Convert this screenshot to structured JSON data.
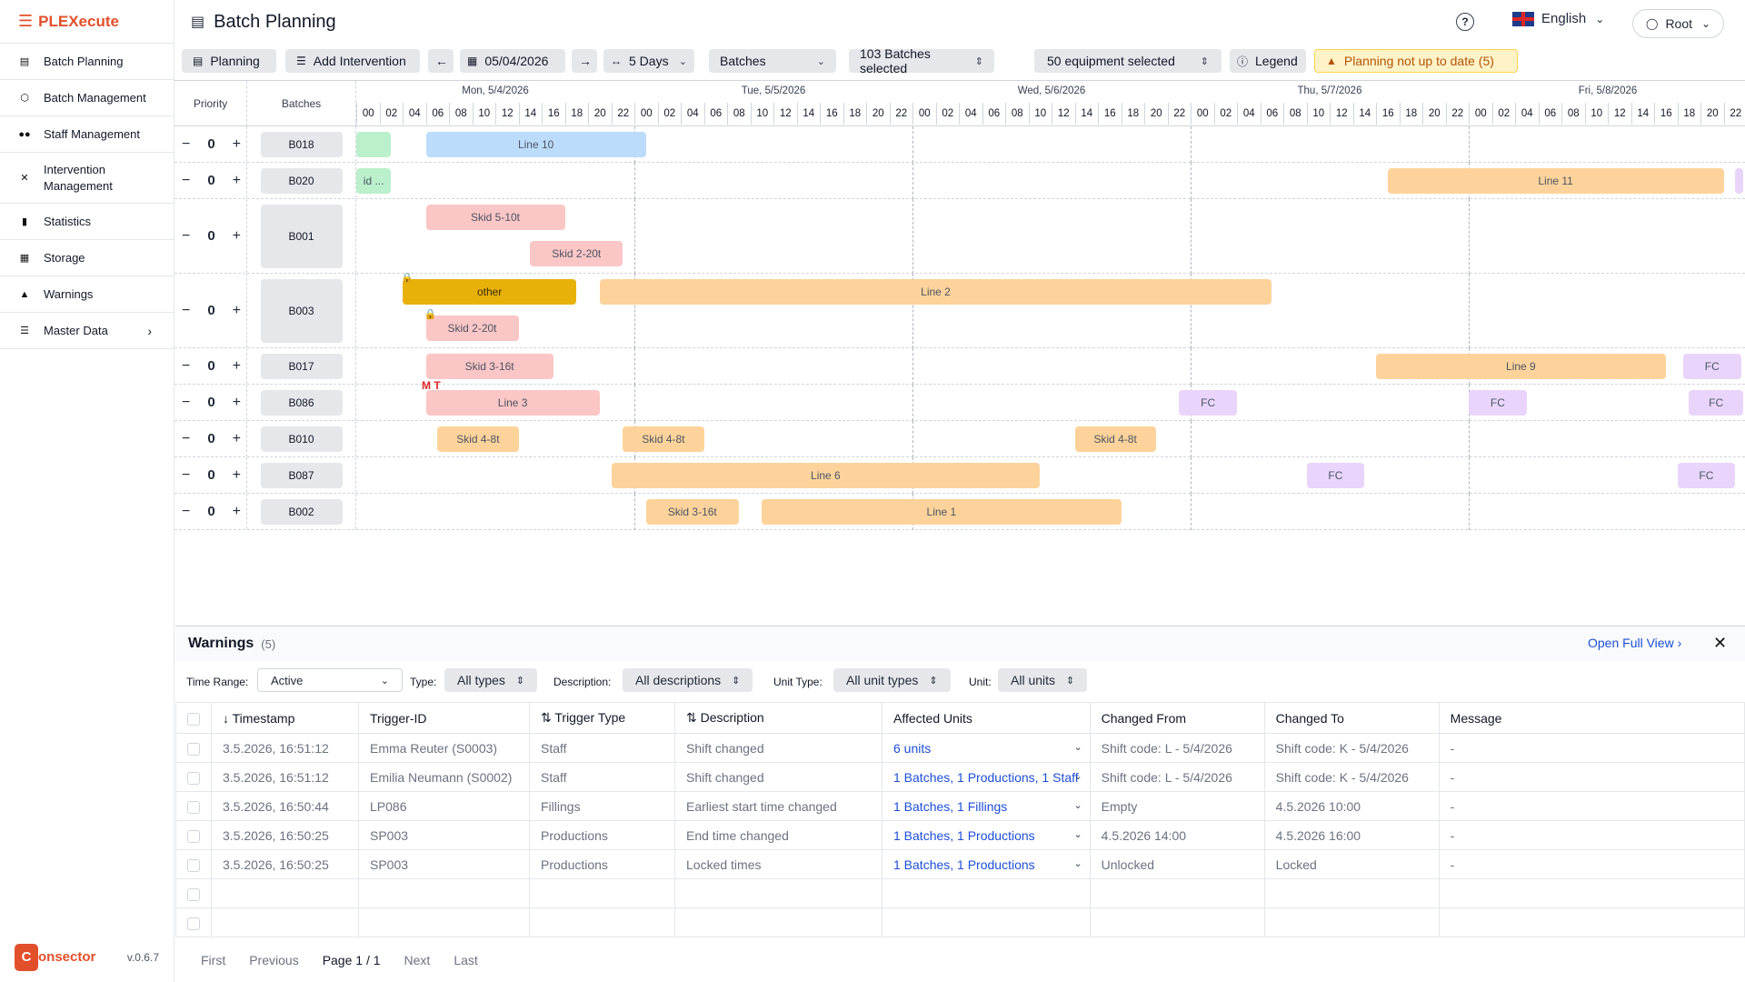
{
  "app": {
    "name": "PLEXecute",
    "version": "v.0.6.7",
    "brand": "onsector",
    "brand_letter": "C"
  },
  "sidebar": {
    "items": [
      {
        "label": "Batch Planning",
        "icon": "gantt-icon"
      },
      {
        "label": "Batch Management",
        "icon": "cube-icon"
      },
      {
        "label": "Staff Management",
        "icon": "people-icon"
      },
      {
        "label": "Intervention Management",
        "icon": "tools-icon"
      },
      {
        "label": "Statistics",
        "icon": "bar-chart-icon"
      },
      {
        "label": "Storage",
        "icon": "boxes-icon"
      },
      {
        "label": "Warnings",
        "icon": "warning-icon"
      },
      {
        "label": "Master Data",
        "icon": "database-icon"
      }
    ]
  },
  "header": {
    "title": "Batch Planning",
    "language": "English",
    "user": "Root",
    "help": "?"
  },
  "toolbar": {
    "planning": "Planning",
    "add_intervention": "Add Intervention",
    "date": "05/04/2026",
    "range": "5 Days",
    "view": "Batches",
    "batches_selected": "103 Batches selected",
    "equipment_selected": "50 equipment selected",
    "legend": "Legend",
    "warning": "Planning not up to date (5)"
  },
  "gantt": {
    "priority_header": "Priority",
    "batches_header": "Batches",
    "days": [
      "Mon, 5/4/2026",
      "Tue, 5/5/2026",
      "Wed, 5/6/2026",
      "Thu, 5/7/2026",
      "Fri, 5/8/2026"
    ],
    "hours": [
      "00",
      "02",
      "04",
      "06",
      "08",
      "10",
      "12",
      "14",
      "16",
      "18",
      "20",
      "22"
    ],
    "colors": {
      "orange": "#fdd39b",
      "pink": "#fbc6c6",
      "blue": "#bcdcfb",
      "green": "#bbf0cc",
      "purple": "#e9d5fb",
      "yellow": "#e8b10a"
    },
    "rows": [
      {
        "batch": "B018",
        "priority": "0",
        "bars": [
          {
            "label": "",
            "color": "green",
            "start_h": 0,
            "end_h": 3.0
          },
          {
            "label": "Line 10",
            "color": "blue",
            "start_h": 6.0,
            "end_h": 25.0
          }
        ]
      },
      {
        "batch": "B020",
        "priority": "0",
        "bars": [
          {
            "label": "id ...",
            "color": "green",
            "start_h": 0,
            "end_h": 3.0
          },
          {
            "label": "Line 11",
            "color": "orange",
            "start_h": 89.0,
            "end_h": 118.0
          },
          {
            "label": "",
            "color": "purple",
            "start_h": 119.0,
            "end_h": 121.0
          }
        ]
      },
      {
        "batch": "B001",
        "priority": "0",
        "bars": [
          {
            "label": "Skid 5-10t",
            "color": "pink",
            "start_h": 6.0,
            "end_h": 18.0
          },
          {
            "label": "Skid 2-20t",
            "color": "pink",
            "start_h": 15.0,
            "end_h": 23.0,
            "lane": 1
          }
        ]
      },
      {
        "batch": "B003",
        "priority": "0",
        "bars": [
          {
            "label": "other",
            "color": "yellow",
            "start_h": 4.0,
            "end_h": 19.0,
            "lock": true
          },
          {
            "label": "Line 2",
            "color": "orange",
            "start_h": 21.0,
            "end_h": 79.0
          },
          {
            "label": "Skid 2-20t",
            "color": "pink",
            "start_h": 6.0,
            "end_h": 14.0,
            "lane": 1,
            "lock": true
          }
        ]
      },
      {
        "batch": "B017",
        "priority": "0",
        "bars": [
          {
            "label": "Skid 3-16t",
            "color": "pink",
            "start_h": 6.0,
            "end_h": 17.0
          },
          {
            "label": "Line 9",
            "color": "orange",
            "start_h": 88.0,
            "end_h": 113.0
          },
          {
            "label": "FC",
            "color": "purple",
            "start_h": 114.5,
            "end_h": 119.5
          }
        ]
      },
      {
        "batch": "B086",
        "priority": "0",
        "markers": "M T",
        "bars": [
          {
            "label": "Line 3",
            "color": "pink",
            "start_h": 6.0,
            "end_h": 21.0
          },
          {
            "label": "FC",
            "color": "purple",
            "start_h": 71.0,
            "end_h": 76.0
          },
          {
            "label": "FC",
            "color": "purple",
            "start_h": 96.0,
            "end_h": 101.0
          },
          {
            "label": "FC",
            "color": "purple",
            "start_h": 115.0,
            "end_h": 120.0
          }
        ]
      },
      {
        "batch": "B010",
        "priority": "0",
        "bars": [
          {
            "label": "Skid 4-8t",
            "color": "orange",
            "start_h": 7.0,
            "end_h": 14.0
          },
          {
            "label": "Skid 4-8t",
            "color": "orange",
            "start_h": 23.0,
            "end_h": 30.0
          },
          {
            "label": "Skid 4-8t",
            "color": "orange",
            "start_h": 62.0,
            "end_h": 69.0
          }
        ]
      },
      {
        "batch": "B087",
        "priority": "0",
        "bars": [
          {
            "label": "Line 6",
            "color": "orange",
            "start_h": 22.0,
            "end_h": 59.0
          },
          {
            "label": "FC",
            "color": "purple",
            "start_h": 82.0,
            "end_h": 87.0
          },
          {
            "label": "FC",
            "color": "purple",
            "start_h": 114.0,
            "end_h": 119.0
          }
        ]
      },
      {
        "batch": "B002",
        "priority": "0",
        "bars": [
          {
            "label": "Skid 3-16t",
            "color": "orange",
            "start_h": 25.0,
            "end_h": 33.0
          },
          {
            "label": "Line 1",
            "color": "orange",
            "start_h": 35.0,
            "end_h": 66.0
          }
        ]
      }
    ]
  },
  "warnings": {
    "title": "Warnings",
    "count": "(5)",
    "open_full": "Open Full View",
    "filters": {
      "time_range_label": "Time Range:",
      "time_range": "Active",
      "type_label": "Type:",
      "type": "All types",
      "description_label": "Description:",
      "description": "All descriptions",
      "unit_type_label": "Unit Type:",
      "unit_type": "All unit types",
      "unit_label": "Unit:",
      "unit": "All units"
    },
    "columns": [
      "Timestamp",
      "Trigger-ID",
      "Trigger Type",
      "Description",
      "Affected Units",
      "Changed From",
      "Changed To",
      "Message"
    ],
    "rows": [
      {
        "timestamp": "3.5.2026, 16:51:12",
        "trigger_id": "Emma Reuter (S0003)",
        "trigger_type": "Staff",
        "description": "Shift changed",
        "affected": "6 units",
        "from": "Shift code: L - 5/4/2026",
        "to": "Shift code: K - 5/4/2026",
        "message": "-"
      },
      {
        "timestamp": "3.5.2026, 16:51:12",
        "trigger_id": "Emilia Neumann (S0002)",
        "trigger_type": "Staff",
        "description": "Shift changed",
        "affected": "1 Batches, 1 Productions, 1 Staff",
        "from": "Shift code: L - 5/4/2026",
        "to": "Shift code: K - 5/4/2026",
        "message": "-"
      },
      {
        "timestamp": "3.5.2026, 16:50:44",
        "trigger_id": "LP086",
        "trigger_type": "Fillings",
        "description": "Earliest start time changed",
        "affected": "1 Batches, 1 Fillings",
        "from": "Empty",
        "to": "4.5.2026 10:00",
        "message": "-"
      },
      {
        "timestamp": "3.5.2026, 16:50:25",
        "trigger_id": "SP003",
        "trigger_type": "Productions",
        "description": "End time changed",
        "affected": "1 Batches, 1 Productions",
        "from": "4.5.2026 14:00",
        "to": "4.5.2026 16:00",
        "message": "-"
      },
      {
        "timestamp": "3.5.2026, 16:50:25",
        "trigger_id": "SP003",
        "trigger_type": "Productions",
        "description": "Locked times",
        "affected": "1 Batches, 1 Productions",
        "from": "Unlocked",
        "to": "Locked",
        "message": "-"
      }
    ],
    "pager": {
      "first": "First",
      "previous": "Previous",
      "page": "Page 1 / 1",
      "next": "Next",
      "last": "Last"
    }
  }
}
